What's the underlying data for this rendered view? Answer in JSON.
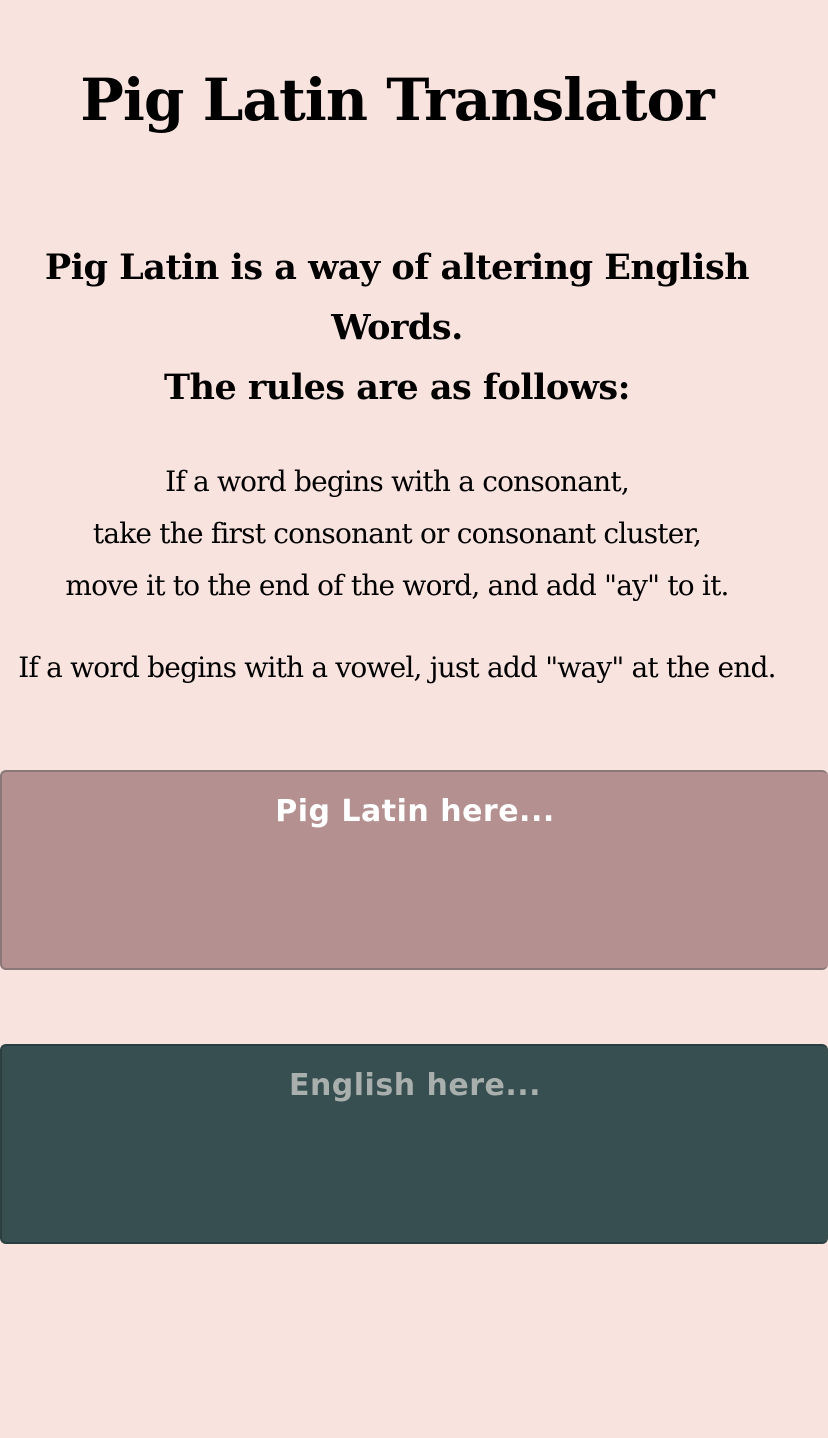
{
  "page": {
    "title": "Pig Latin Translator"
  },
  "intro": {
    "line1": "Pig Latin is a way of altering English",
    "line2": "Words.",
    "line3": "The rules are as follows:"
  },
  "rules": {
    "consonant": [
      "If a word begins with a consonant,",
      "take the first consonant or consonant cluster,",
      "move it to the end of the word, and add \"ay\" to it."
    ],
    "vowel": "If a word begins with a vowel, just add \"way\" at the end."
  },
  "pig_latin_box": {
    "placeholder": "Pig Latin here...",
    "value": ""
  },
  "english_box": {
    "placeholder": "English here...",
    "value": ""
  },
  "colors": {
    "background": "#f9e3df",
    "pig_latin_box": "#b49090",
    "english_box": "#374f50",
    "pig_latin_text": "#ffffff",
    "english_text": "#a9afad"
  }
}
